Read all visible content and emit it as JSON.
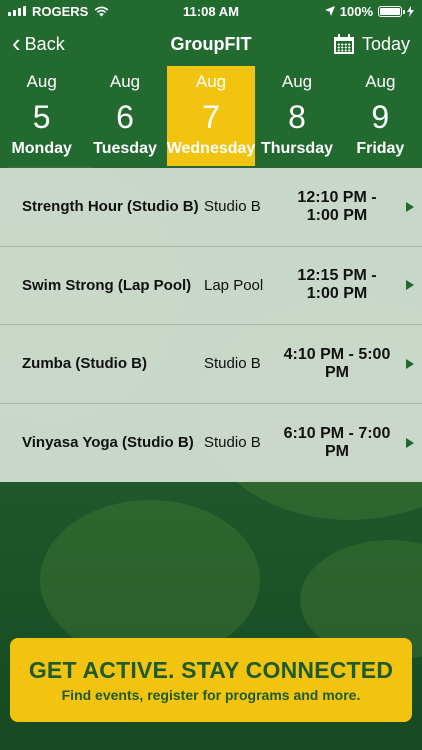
{
  "status_bar": {
    "carrier": "ROGERS",
    "time": "11:08 AM",
    "battery_text": "100%"
  },
  "nav": {
    "back_label": "Back",
    "title": "GroupFIT",
    "today_label": "Today"
  },
  "dates": [
    {
      "month": "Aug",
      "day": "5",
      "weekday": "Monday",
      "selected": false
    },
    {
      "month": "Aug",
      "day": "6",
      "weekday": "Tuesday",
      "selected": false
    },
    {
      "month": "Aug",
      "day": "7",
      "weekday": "Wednesday",
      "selected": true
    },
    {
      "month": "Aug",
      "day": "8",
      "weekday": "Thursday",
      "selected": false
    },
    {
      "month": "Aug",
      "day": "9",
      "weekday": "Friday",
      "selected": false
    }
  ],
  "classes": [
    {
      "name": "Strength Hour (Studio B)",
      "location": "Studio B",
      "time": "12:10 PM - 1:00 PM"
    },
    {
      "name": "Swim Strong (Lap Pool)",
      "location": "Lap Pool",
      "time": "12:15 PM - 1:00 PM"
    },
    {
      "name": "Zumba (Studio B)",
      "location": "Studio B",
      "time": "4:10 PM - 5:00 PM"
    },
    {
      "name": "Vinyasa Yoga (Studio B)",
      "location": "Studio B",
      "time": "6:10 PM - 7:00 PM"
    }
  ],
  "banner": {
    "title": "GET ACTIVE.  STAY CONNECTED",
    "subtitle": "Find events, register for programs and more."
  },
  "colors": {
    "brand_green": "#236a31",
    "accent_gold": "#f2c40f"
  },
  "icons": {
    "wifi": "wifi-icon",
    "location": "location-arrow-icon",
    "charging": "charging-bolt-icon",
    "calendar": "calendar-icon"
  }
}
